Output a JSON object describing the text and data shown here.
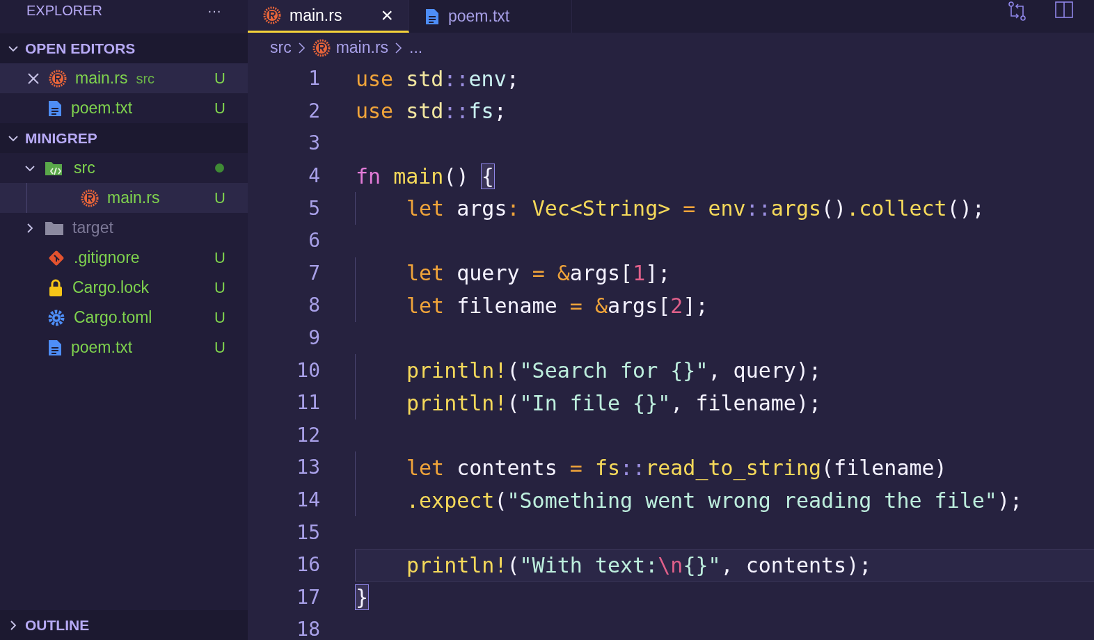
{
  "sidebar": {
    "title": "EXPLORER",
    "more": "···",
    "open_editors": {
      "title": "OPEN EDITORS",
      "expanded": true,
      "items": [
        {
          "name": "main.rs",
          "description": "src",
          "kind": "rust",
          "badge": "U",
          "selected": true
        },
        {
          "name": "poem.txt",
          "kind": "file",
          "badge": "U",
          "selected": false
        }
      ]
    },
    "project": {
      "title": "MINIGREP",
      "expanded": true,
      "items": [
        {
          "name": "src",
          "kind": "folder-src",
          "expanded": true,
          "modified_dot": true,
          "selected": false,
          "children": [
            {
              "name": "main.rs",
              "kind": "rust",
              "badge": "U",
              "selected": true
            }
          ]
        },
        {
          "name": "target",
          "kind": "folder",
          "expanded": false,
          "ignored": true,
          "selected": false
        },
        {
          "name": ".gitignore",
          "kind": "git",
          "badge": "U",
          "selected": false
        },
        {
          "name": "Cargo.lock",
          "kind": "lock",
          "badge": "U",
          "selected": false
        },
        {
          "name": "Cargo.toml",
          "kind": "gear",
          "badge": "U",
          "selected": false
        },
        {
          "name": "poem.txt",
          "kind": "file",
          "badge": "U",
          "selected": false
        }
      ]
    },
    "outline": {
      "title": "OUTLINE",
      "expanded": false
    }
  },
  "tabs": [
    {
      "label": "main.rs",
      "kind": "rust",
      "selected": true,
      "close": "×"
    },
    {
      "label": "poem.txt",
      "kind": "file",
      "selected": false
    }
  ],
  "breadcrumb": [
    {
      "label": "src"
    },
    {
      "label": "main.rs",
      "kind": "rust"
    },
    {
      "label": "..."
    }
  ],
  "editor": {
    "lines": [
      {
        "number": "1",
        "indented": false,
        "current": false,
        "tokens": [
          {
            "t": "use ",
            "kind": "kw"
          },
          {
            "t": "std",
            "kind": "type"
          },
          {
            "t": "::",
            "kind": "punct"
          },
          {
            "t": "env",
            "kind": "ident"
          },
          {
            "t": ";",
            "kind": "plain"
          }
        ]
      },
      {
        "number": "2",
        "indented": false,
        "current": false,
        "tokens": [
          {
            "t": "use ",
            "kind": "kw"
          },
          {
            "t": "std",
            "kind": "type"
          },
          {
            "t": "::",
            "kind": "punct"
          },
          {
            "t": "fs",
            "kind": "ident"
          },
          {
            "t": ";",
            "kind": "plain"
          }
        ]
      },
      {
        "number": "3",
        "indented": false,
        "current": false
      },
      {
        "number": "4",
        "indented": false,
        "current": false,
        "tokens": [
          {
            "t": "fn ",
            "kind": "fn"
          },
          {
            "t": "main",
            "kind": "func"
          },
          {
            "t": "() ",
            "kind": "plain"
          },
          {
            "t": "{",
            "kind": "plain",
            "matched": true
          }
        ]
      },
      {
        "number": "5",
        "indented": true,
        "current": false,
        "tokens": [
          {
            "t": "let",
            "kind": "kw"
          },
          {
            "t": " args",
            "kind": "plain"
          },
          {
            "t": ": ",
            "kind": "kw"
          },
          {
            "t": "Vec<String>",
            "kind": "func"
          },
          {
            "t": " = ",
            "kind": "op"
          },
          {
            "t": "env",
            "kind": "func"
          },
          {
            "t": "::",
            "kind": "punct"
          },
          {
            "t": "args",
            "kind": "func"
          },
          {
            "t": "()",
            "kind": "plain"
          },
          {
            "t": ".collect",
            "kind": "func"
          },
          {
            "t": "();",
            "kind": "plain"
          }
        ]
      },
      {
        "number": "6",
        "indented": false,
        "current": false
      },
      {
        "number": "7",
        "indented": true,
        "current": false,
        "tokens": [
          {
            "t": "let",
            "kind": "kw"
          },
          {
            "t": " query ",
            "kind": "plain"
          },
          {
            "t": "= &",
            "kind": "op"
          },
          {
            "t": "args[",
            "kind": "plain"
          },
          {
            "t": "1",
            "kind": "num"
          },
          {
            "t": "];",
            "kind": "plain"
          }
        ]
      },
      {
        "number": "8",
        "indented": true,
        "current": false,
        "tokens": [
          {
            "t": "let",
            "kind": "kw"
          },
          {
            "t": " filename ",
            "kind": "plain"
          },
          {
            "t": "= &",
            "kind": "op"
          },
          {
            "t": "args[",
            "kind": "plain"
          },
          {
            "t": "2",
            "kind": "num"
          },
          {
            "t": "];",
            "kind": "plain"
          }
        ]
      },
      {
        "number": "9",
        "indented": false,
        "current": false
      },
      {
        "number": "10",
        "indented": true,
        "current": false,
        "tokens": [
          {
            "t": "println!",
            "kind": "func"
          },
          {
            "t": "(",
            "kind": "plain"
          },
          {
            "t": "\"Search for {}\"",
            "kind": "str"
          },
          {
            "t": ", query);",
            "kind": "plain"
          }
        ]
      },
      {
        "number": "11",
        "indented": true,
        "current": false,
        "tokens": [
          {
            "t": "println!",
            "kind": "func"
          },
          {
            "t": "(",
            "kind": "plain"
          },
          {
            "t": "\"In file {}\"",
            "kind": "str"
          },
          {
            "t": ", filename);",
            "kind": "plain"
          }
        ]
      },
      {
        "number": "12",
        "indented": false,
        "current": false
      },
      {
        "number": "13",
        "indented": true,
        "current": false,
        "tokens": [
          {
            "t": "let",
            "kind": "kw"
          },
          {
            "t": " contents ",
            "kind": "plain"
          },
          {
            "t": "= ",
            "kind": "op"
          },
          {
            "t": "fs",
            "kind": "func"
          },
          {
            "t": "::",
            "kind": "punct"
          },
          {
            "t": "read_to_string",
            "kind": "func"
          },
          {
            "t": "(filename)",
            "kind": "plain"
          }
        ]
      },
      {
        "number": "14",
        "indented": true,
        "current": false,
        "tokens": [
          {
            "t": ".expect",
            "kind": "func"
          },
          {
            "t": "(",
            "kind": "plain"
          },
          {
            "t": "\"Something went wrong reading the file\"",
            "kind": "str"
          },
          {
            "t": ");",
            "kind": "plain"
          }
        ]
      },
      {
        "number": "15",
        "indented": false,
        "current": false
      },
      {
        "number": "16",
        "indented": true,
        "current": true,
        "tokens": [
          {
            "t": "println!",
            "kind": "func"
          },
          {
            "t": "(",
            "kind": "plain"
          },
          {
            "t": "\"With text:",
            "kind": "str"
          },
          {
            "t": "\\n",
            "kind": "num"
          },
          {
            "t": "{}\"",
            "kind": "str"
          },
          {
            "t": ", contents);",
            "kind": "plain"
          }
        ]
      },
      {
        "number": "17",
        "indented": false,
        "current": false,
        "tokens": [
          {
            "t": "}",
            "kind": "plain",
            "matched": true
          }
        ]
      },
      {
        "number": "18",
        "indented": false,
        "current": false
      }
    ]
  }
}
